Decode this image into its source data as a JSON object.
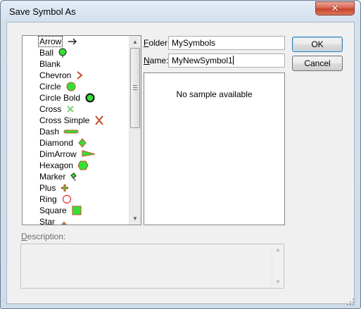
{
  "window": {
    "title": "Save Symbol As",
    "close_glyph": "✕"
  },
  "symbols": {
    "selected": "Arrow",
    "items": [
      {
        "label": "Arrow",
        "icon": "arrow-icon"
      },
      {
        "label": "Ball",
        "icon": "ball-icon"
      },
      {
        "label": "Blank",
        "icon": "blank-icon"
      },
      {
        "label": "Chevron",
        "icon": "chevron-icon"
      },
      {
        "label": "Circle",
        "icon": "circle-icon"
      },
      {
        "label": "Circle Bold",
        "icon": "circle-bold-icon"
      },
      {
        "label": "Cross",
        "icon": "cross-icon"
      },
      {
        "label": "Cross Simple",
        "icon": "cross-simple-icon"
      },
      {
        "label": "Dash",
        "icon": "dash-icon"
      },
      {
        "label": "Diamond",
        "icon": "diamond-icon"
      },
      {
        "label": "DimArrow",
        "icon": "dim-arrow-icon"
      },
      {
        "label": "Hexagon",
        "icon": "hexagon-icon"
      },
      {
        "label": "Marker",
        "icon": "marker-icon"
      },
      {
        "label": "Plus",
        "icon": "plus-icon"
      },
      {
        "label": "Ring",
        "icon": "ring-icon"
      },
      {
        "label": "Square",
        "icon": "square-icon"
      },
      {
        "label": "Star",
        "icon": "star-icon"
      }
    ]
  },
  "folder": {
    "label_underlined": "F",
    "label_rest": "older:",
    "value": "MySymbols"
  },
  "name": {
    "label_underlined": "N",
    "label_rest": "ame:",
    "value": "MyNewSymbol1"
  },
  "preview": {
    "text": "No sample available"
  },
  "buttons": {
    "ok": "OK",
    "cancel": "Cancel"
  },
  "description": {
    "label_underlined": "D",
    "label_rest": "escription:",
    "value": ""
  },
  "colors": {
    "symbol_fill": "#33e133",
    "symbol_stroke": "#c0502c",
    "accent": "#3c7fb1"
  }
}
